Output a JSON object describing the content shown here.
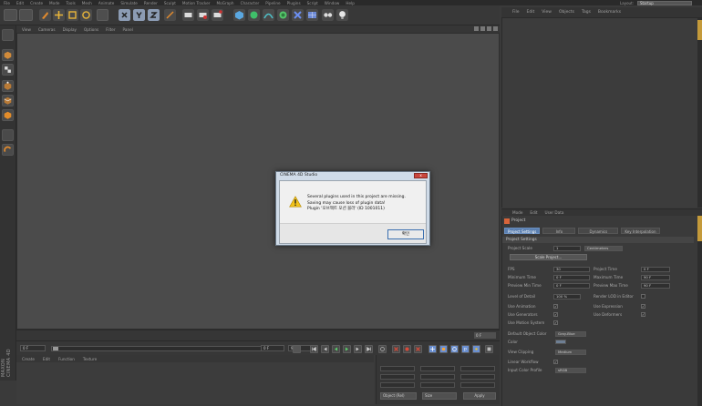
{
  "menubar": {
    "items": [
      "File",
      "Edit",
      "Create",
      "Mode",
      "Tools",
      "Mesh",
      "Animate",
      "Simulate",
      "Render",
      "Sculpt",
      "Motion Tracker",
      "MoGraph",
      "Character",
      "Pipeline",
      "Plugins",
      "Script",
      "Window",
      "Help"
    ],
    "layout_label": "Layout:",
    "layout_value": "Startup"
  },
  "viewport": {
    "menu": [
      "View",
      "Cameras",
      "Display",
      "Options",
      "Filter",
      "Panel"
    ]
  },
  "timeline": {
    "frame_tag": "0 F",
    "start_field": "0 F",
    "current_field": "0 F",
    "end_field": "90 F"
  },
  "materials": {
    "menu": [
      "Create",
      "Edit",
      "Function",
      "Texture"
    ]
  },
  "coordinates": {
    "object_rel": "Object (Rel)",
    "size": "Size",
    "apply": "Apply"
  },
  "object_manager": {
    "menu": [
      "File",
      "Edit",
      "View",
      "Objects",
      "Tags",
      "Bookmarks"
    ]
  },
  "attribute_manager": {
    "menu": [
      "Mode",
      "Edit",
      "User Data"
    ],
    "title": "Project",
    "tabs": [
      "Project Settings",
      "Info",
      "Dynamics",
      "Key Interpolation"
    ],
    "section": "Project Settings",
    "labels": {
      "project_scale": "Project Scale",
      "scale_project": "Scale Project...",
      "fps": "FPS",
      "minimum_time": "Minimum Time",
      "preview_min_time": "Preview Min Time",
      "project_time": "Project Time",
      "maximum_time": "Maximum Time",
      "preview_max_time": "Preview Max Time",
      "level_of_detail": "Level of Detail",
      "render_lod": "Render LOD in Editor",
      "use_animation": "Use Animation",
      "use_expression": "Use Expression",
      "use_generators": "Use Generators",
      "use_deformers": "Use Deformers",
      "use_motion_system": "Use Motion System",
      "default_object_color": "Default Object Color",
      "color": "Color",
      "view_clipping": "View Clipping",
      "linear_workflow": "Linear Workflow",
      "input_color_profile": "Input Color Profile"
    },
    "values": {
      "project_scale": "1",
      "project_scale_unit": "Centimeters",
      "fps": "30",
      "minimum_time": "0 F",
      "preview_min_time": "0 F",
      "project_time": "0 F",
      "maximum_time": "90 F",
      "preview_max_time": "90 F",
      "level_of_detail": "100 %",
      "default_object_color": "Gray-Blue",
      "view_clipping": "Medium",
      "input_color_profile": "sRGB"
    },
    "checkmark": "✓"
  },
  "dialog": {
    "title": "CINEMA 4D Studio",
    "close": "x",
    "lines": [
      "Several plugins used in this project are missing.",
      "Saving may cause loss of plugin data!",
      "Plugin '오브젝트 모션 블러' (ID 1001011)"
    ],
    "ok": "확인"
  },
  "brand": {
    "line1": "MAXON",
    "line2": "CINEMA 4D"
  }
}
